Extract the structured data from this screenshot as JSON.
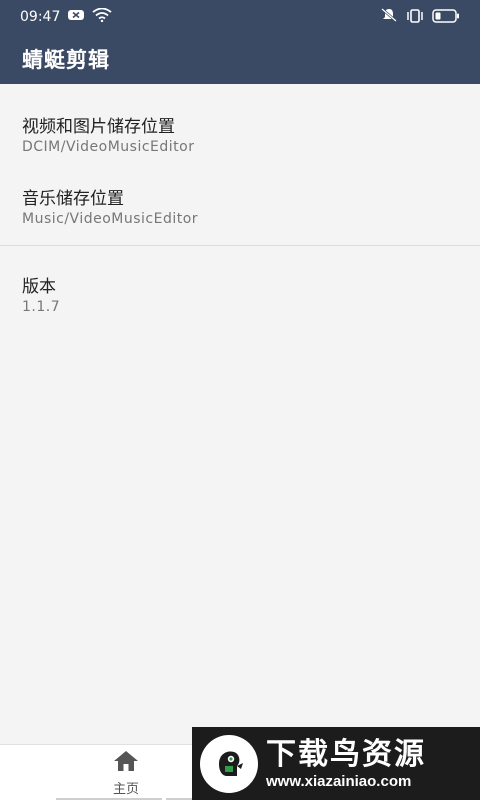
{
  "status_bar": {
    "time": "09:47",
    "icons": [
      "notification-icon",
      "wifi-icon",
      "mute-icon",
      "vibrate-icon",
      "battery-icon"
    ]
  },
  "app_bar": {
    "title": "蜻蜓剪辑"
  },
  "settings": {
    "video_location": {
      "title": "视频和图片储存位置",
      "value": "DCIM/VideoMusicEditor"
    },
    "music_location": {
      "title": "音乐储存位置",
      "value": "Music/VideoMusicEditor"
    },
    "version": {
      "title": "版本",
      "value": "1.1.7"
    }
  },
  "bottom_nav": {
    "home_label": "主页",
    "home_icon": "home-icon"
  },
  "watermark": {
    "title": "下载鸟资源",
    "url": "www.xiazainiao.com"
  },
  "colors": {
    "primary": "#3b4a64",
    "background": "#f4f4f4",
    "watermark_bg": "#1c1c1c"
  }
}
